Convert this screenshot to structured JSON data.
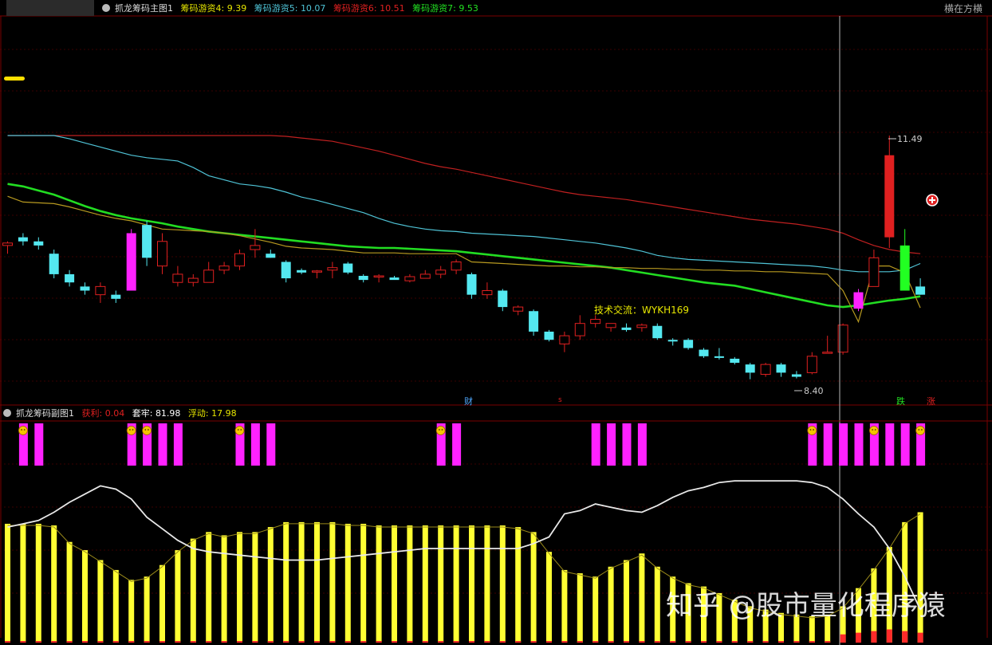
{
  "main_panel": {
    "title": "抓龙筹码主图1",
    "indicators": [
      {
        "label": "筹码游资4:",
        "value": "9.39",
        "color": "#e6e600"
      },
      {
        "label": "筹码游资5:",
        "value": "10.07",
        "color": "#4fc3d6"
      },
      {
        "label": "筹码游资6:",
        "value": "10.51",
        "color": "#e02020"
      },
      {
        "label": "筹码游资7:",
        "value": "9.53",
        "color": "#22e022"
      }
    ],
    "top_right_label": "横在方横",
    "annotations": {
      "high_label": "11.49",
      "low_label": "8.40",
      "tech_note": "技术交流：WYKH169",
      "marker_cai": "财",
      "marker_s": "s",
      "marker_die": "跌",
      "marker_zhang": "涨"
    }
  },
  "sub_panel": {
    "title": "抓龙筹码副图1",
    "indicators": [
      {
        "label": "获利:",
        "value": "0.04",
        "color": "#e02020"
      },
      {
        "label": "套牢:",
        "value": "81.98",
        "color": "#ffffff"
      },
      {
        "label": "浮动:",
        "value": "17.98",
        "color": "#e6e600"
      }
    ]
  },
  "watermark": "知乎 @股市量化程序猿",
  "chart_data": [
    {
      "type": "candlestick",
      "title": "抓龙筹码主图1",
      "ylim": [
        8.0,
        12.0
      ],
      "candles": [
        [
          10.15,
          10.2,
          10.05,
          10.18
        ],
        [
          10.25,
          10.3,
          10.15,
          10.2
        ],
        [
          10.2,
          10.25,
          10.1,
          10.15
        ],
        [
          10.05,
          10.1,
          9.75,
          9.8
        ],
        [
          9.8,
          9.85,
          9.65,
          9.7
        ],
        [
          9.65,
          9.7,
          9.55,
          9.6
        ],
        [
          9.55,
          9.7,
          9.45,
          9.65
        ],
        [
          9.55,
          9.6,
          9.45,
          9.5
        ],
        [
          9.6,
          10.35,
          9.6,
          10.3
        ],
        [
          10.4,
          10.45,
          9.9,
          10.0
        ],
        [
          9.9,
          10.3,
          9.8,
          10.2
        ],
        [
          9.7,
          9.9,
          9.65,
          9.8
        ],
        [
          9.7,
          9.8,
          9.65,
          9.75
        ],
        [
          9.7,
          9.95,
          9.7,
          9.85
        ],
        [
          9.85,
          9.95,
          9.8,
          9.9
        ],
        [
          9.9,
          10.1,
          9.85,
          10.05
        ],
        [
          10.1,
          10.35,
          10.0,
          10.15
        ],
        [
          10.05,
          10.1,
          10.0,
          10.0
        ],
        [
          9.95,
          9.97,
          9.7,
          9.75
        ],
        [
          9.85,
          9.87,
          9.8,
          9.82
        ],
        [
          9.83,
          9.85,
          9.75,
          9.84
        ],
        [
          9.85,
          9.95,
          9.75,
          9.88
        ],
        [
          9.93,
          9.95,
          9.8,
          9.82
        ],
        [
          9.78,
          9.8,
          9.7,
          9.73
        ],
        [
          9.78,
          9.8,
          9.7,
          9.78
        ],
        [
          9.76,
          9.78,
          9.74,
          9.73
        ],
        [
          9.72,
          9.8,
          9.7,
          9.77
        ],
        [
          9.75,
          9.85,
          9.75,
          9.8
        ],
        [
          9.8,
          9.9,
          9.75,
          9.85
        ],
        [
          9.85,
          9.98,
          9.8,
          9.95
        ],
        [
          9.8,
          9.82,
          9.5,
          9.55
        ],
        [
          9.55,
          9.7,
          9.5,
          9.6
        ],
        [
          9.6,
          9.62,
          9.35,
          9.4
        ],
        [
          9.35,
          9.42,
          9.3,
          9.4
        ],
        [
          9.35,
          9.37,
          9.05,
          9.1
        ],
        [
          9.1,
          9.12,
          8.98,
          9.0
        ],
        [
          8.95,
          9.1,
          8.85,
          9.05
        ],
        [
          9.05,
          9.3,
          9.0,
          9.2
        ],
        [
          9.2,
          9.3,
          9.15,
          9.25
        ],
        [
          9.15,
          9.2,
          9.1,
          9.2
        ],
        [
          9.15,
          9.2,
          9.1,
          9.12
        ],
        [
          9.15,
          9.2,
          9.1,
          9.18
        ],
        [
          9.17,
          9.2,
          9.0,
          9.02
        ],
        [
          9.0,
          9.02,
          8.93,
          8.98
        ],
        [
          9.0,
          9.02,
          8.88,
          8.9
        ],
        [
          8.88,
          8.9,
          8.78,
          8.8
        ],
        [
          8.8,
          8.9,
          8.76,
          8.78
        ],
        [
          8.77,
          8.79,
          8.7,
          8.72
        ],
        [
          8.7,
          8.72,
          8.52,
          8.6
        ],
        [
          8.58,
          8.72,
          8.55,
          8.7
        ],
        [
          8.7,
          8.72,
          8.55,
          8.6
        ],
        [
          8.58,
          8.62,
          8.53,
          8.55
        ],
        [
          8.6,
          8.85,
          8.58,
          8.8
        ],
        [
          8.85,
          9.05,
          8.85,
          8.85
        ],
        [
          8.85,
          9.2,
          8.82,
          9.18
        ],
        [
          9.38,
          9.62,
          9.35,
          9.58
        ],
        [
          9.65,
          10.1,
          9.65,
          10.0
        ],
        [
          10.25,
          11.49,
          10.12,
          11.25
        ],
        [
          10.15,
          10.35,
          9.6,
          9.6
        ],
        [
          9.65,
          9.75,
          9.55,
          9.55
        ]
      ],
      "series": [
        {
          "name": "筹码游资6",
          "color": "#c02020",
          "values": [
            11.49,
            11.49,
            11.49,
            11.49,
            11.49,
            11.49,
            11.49,
            11.49,
            11.49,
            11.49,
            11.49,
            11.49,
            11.49,
            11.49,
            11.49,
            11.49,
            11.49,
            11.49,
            11.48,
            11.46,
            11.44,
            11.42,
            11.38,
            11.34,
            11.3,
            11.25,
            11.2,
            11.15,
            11.11,
            11.08,
            11.04,
            11.0,
            10.96,
            10.92,
            10.88,
            10.84,
            10.8,
            10.77,
            10.75,
            10.73,
            10.71,
            10.68,
            10.65,
            10.62,
            10.59,
            10.56,
            10.53,
            10.5,
            10.47,
            10.45,
            10.43,
            10.41,
            10.38,
            10.35,
            10.3,
            10.22,
            10.15,
            10.1,
            10.07,
            10.05
          ]
        },
        {
          "name": "筹码游资5",
          "color": "#4fc3d6",
          "values": [
            11.49,
            11.49,
            11.49,
            11.49,
            11.45,
            11.4,
            11.35,
            11.3,
            11.25,
            11.22,
            11.2,
            11.18,
            11.1,
            11.0,
            10.95,
            10.9,
            10.88,
            10.85,
            10.8,
            10.74,
            10.7,
            10.65,
            10.6,
            10.55,
            10.48,
            10.42,
            10.38,
            10.35,
            10.33,
            10.32,
            10.3,
            10.29,
            10.28,
            10.27,
            10.26,
            10.24,
            10.22,
            10.2,
            10.18,
            10.15,
            10.12,
            10.08,
            10.03,
            10.0,
            9.98,
            9.97,
            9.96,
            9.95,
            9.94,
            9.93,
            9.92,
            9.91,
            9.9,
            9.88,
            9.85,
            9.83,
            9.83,
            9.83,
            9.85,
            9.93
          ]
        },
        {
          "name": "筹码游资7",
          "color": "#22dd22",
          "values": [
            10.9,
            10.87,
            10.82,
            10.77,
            10.7,
            10.63,
            10.57,
            10.52,
            10.48,
            10.45,
            10.42,
            10.38,
            10.35,
            10.32,
            10.3,
            10.28,
            10.26,
            10.24,
            10.22,
            10.2,
            10.18,
            10.16,
            10.14,
            10.13,
            10.12,
            10.12,
            10.11,
            10.1,
            10.09,
            10.08,
            10.06,
            10.04,
            10.02,
            10.0,
            9.98,
            9.96,
            9.94,
            9.92,
            9.9,
            9.88,
            9.85,
            9.82,
            9.79,
            9.76,
            9.73,
            9.7,
            9.68,
            9.66,
            9.62,
            9.58,
            9.54,
            9.5,
            9.46,
            9.42,
            9.4,
            9.42,
            9.45,
            9.48,
            9.5,
            9.53
          ]
        },
        {
          "name": "筹码游资4",
          "color": "#b89a20",
          "values": [
            10.75,
            10.68,
            10.67,
            10.66,
            10.62,
            10.57,
            10.52,
            10.48,
            10.45,
            10.4,
            10.35,
            10.34,
            10.33,
            10.32,
            10.3,
            10.27,
            10.23,
            10.19,
            10.14,
            10.12,
            10.11,
            10.1,
            10.08,
            10.06,
            10.06,
            10.06,
            10.05,
            10.05,
            10.05,
            10.05,
            9.95,
            9.94,
            9.93,
            9.92,
            9.91,
            9.9,
            9.9,
            9.89,
            9.89,
            9.88,
            9.88,
            9.87,
            9.87,
            9.86,
            9.86,
            9.85,
            9.85,
            9.84,
            9.84,
            9.83,
            9.83,
            9.82,
            9.81,
            9.8,
            9.6,
            9.22,
            9.9,
            9.9,
            9.82,
            9.39
          ]
        }
      ]
    },
    {
      "type": "bar",
      "title": "抓龙筹码副图1",
      "ylim": [
        0,
        100
      ],
      "series": [
        {
          "name": "套牢",
          "color": "#ffff33",
          "values": [
            72,
            72,
            72,
            71,
            61,
            56,
            50,
            44,
            38,
            40,
            47,
            56,
            63,
            67,
            65,
            67,
            67,
            70,
            73,
            73,
            73,
            73,
            72,
            72,
            71,
            71,
            71,
            71,
            71,
            71,
            71,
            71,
            71,
            70,
            67,
            55,
            44,
            42,
            40,
            46,
            50,
            54,
            46,
            40,
            36,
            34,
            30,
            26,
            22,
            20,
            18,
            17,
            16,
            17,
            22,
            33,
            45,
            58,
            73,
            79
          ]
        },
        {
          "name": "获利",
          "color": "#ff2a2a",
          "values": [
            0,
            0,
            0,
            0,
            0,
            0,
            0,
            0,
            0,
            0,
            0,
            0,
            0,
            0,
            0,
            0,
            0,
            0,
            0,
            0,
            0,
            0,
            0,
            0,
            0,
            0,
            0,
            0,
            0,
            0,
            0,
            0,
            0,
            0,
            0,
            0,
            0,
            0,
            0,
            0,
            0,
            0,
            0,
            0,
            0,
            0,
            0,
            0,
            0,
            0,
            0,
            0,
            0,
            0,
            5,
            6,
            7,
            8,
            7,
            6
          ]
        },
        {
          "name": "浮动",
          "color": "#ffffff",
          "values": [
            70,
            72,
            74,
            79,
            85,
            90,
            95,
            93,
            87,
            76,
            69,
            62,
            57,
            55,
            54,
            53,
            52,
            51,
            50,
            50,
            50,
            51,
            52,
            53,
            54,
            55,
            56,
            57,
            57,
            57,
            57,
            57,
            57,
            57,
            60,
            64,
            78,
            80,
            84,
            82,
            80,
            79,
            83,
            88,
            92,
            94,
            97,
            98,
            98,
            98,
            98,
            98,
            97,
            94,
            87,
            78,
            70,
            57,
            40,
            20
          ]
        }
      ],
      "markers_magenta": [
        1,
        2,
        8,
        9,
        10,
        11,
        15,
        16,
        17,
        28,
        29,
        38,
        39,
        40,
        41,
        52,
        53,
        54,
        55,
        56,
        57,
        58,
        59
      ]
    }
  ]
}
